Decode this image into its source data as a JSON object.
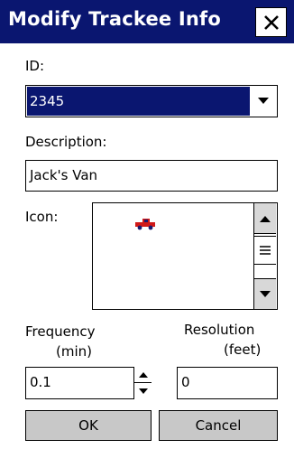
{
  "dialog": {
    "title": "Modify Trackee Info",
    "close_icon": "close-icon"
  },
  "id": {
    "label": "ID:",
    "value": "2345"
  },
  "description": {
    "label": "Description:",
    "value": "Jack's Van"
  },
  "icon": {
    "label": "Icon:",
    "selected_icon": "red-truck-icon",
    "scroll_up_icon": "scroll-up-arrow-icon",
    "scroll_down_icon": "scroll-down-arrow-icon"
  },
  "frequency": {
    "label_line1": "Frequency",
    "label_line2": "(min)",
    "value": "0.1"
  },
  "resolution": {
    "label_line1": "Resolution",
    "label_line2": "(feet)",
    "value": "0"
  },
  "buttons": {
    "ok": "OK",
    "cancel": "Cancel"
  },
  "colors": {
    "title_bar": "#0a1670",
    "selection": "#0a1670",
    "button_face": "#c8c8c8",
    "truck_body": "#d01818",
    "truck_dark": "#1a1a6e"
  }
}
